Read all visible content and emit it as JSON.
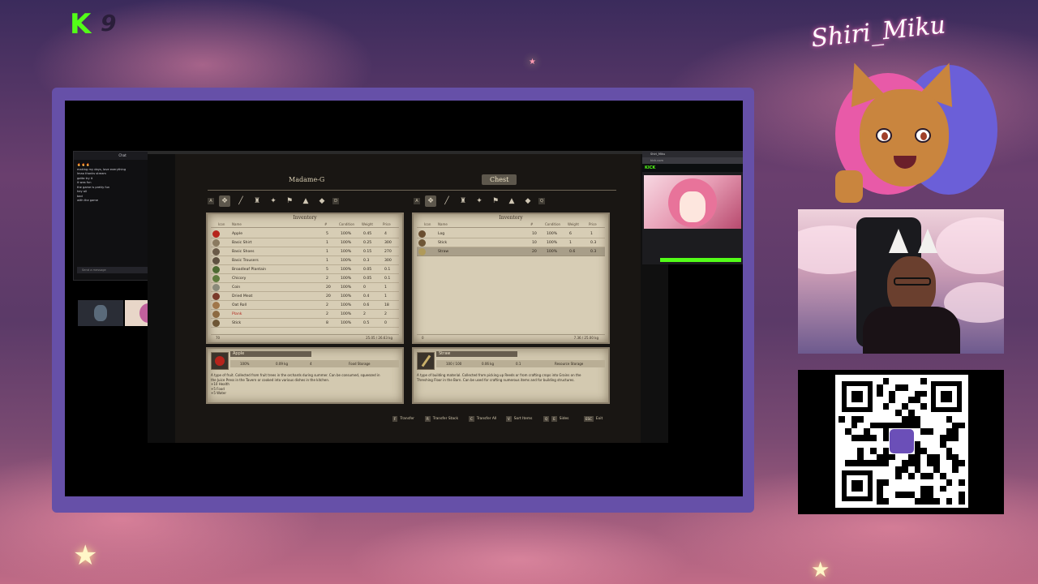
{
  "overlay": {
    "kick_logo": "K",
    "kick_count": "9",
    "brand_name": "Shiri_Miku"
  },
  "game": {
    "left_title": "Madame-G",
    "right_title": "Chest",
    "category_keys": {
      "left_prev": "A",
      "left_next": "D",
      "right_prev": "A",
      "right_next": "Q"
    },
    "left_inventory": {
      "title": "Inventory",
      "columns": [
        "Icon",
        "Name",
        "#",
        "Condition",
        "Weight",
        "Price"
      ],
      "rows": [
        {
          "name": "Apple",
          "count": "5",
          "condition": "100%",
          "weight": "0.45",
          "price": "4",
          "icon": "apple-icon",
          "color": "#b6241c"
        },
        {
          "name": "Basic Shirt",
          "count": "1",
          "condition": "100%",
          "weight": "0.25",
          "price": "300",
          "icon": "shirt-icon",
          "color": "#8a7a60"
        },
        {
          "name": "Basic Shoes",
          "count": "1",
          "condition": "100%",
          "weight": "0.15",
          "price": "270",
          "icon": "shoes-icon",
          "color": "#6a5a48"
        },
        {
          "name": "Basic Trousers",
          "count": "1",
          "condition": "100%",
          "weight": "0.3",
          "price": "300",
          "icon": "trousers-icon",
          "color": "#5e5040"
        },
        {
          "name": "Broadleaf Plantain",
          "count": "5",
          "condition": "100%",
          "weight": "0.05",
          "price": "0.1",
          "icon": "herb-icon",
          "color": "#4d6a32"
        },
        {
          "name": "Chicory",
          "count": "2",
          "condition": "100%",
          "weight": "0.05",
          "price": "0.1",
          "icon": "herb-icon",
          "color": "#5f7b3e"
        },
        {
          "name": "Coin",
          "count": "20",
          "condition": "100%",
          "weight": "0",
          "price": "1",
          "icon": "coin-icon",
          "color": "#8a8a7a"
        },
        {
          "name": "Dried Meat",
          "count": "20",
          "condition": "100%",
          "weight": "0.4",
          "price": "1",
          "icon": "meat-icon",
          "color": "#7a3a2a"
        },
        {
          "name": "Oat Roll",
          "count": "2",
          "condition": "100%",
          "weight": "0.6",
          "price": "18",
          "icon": "bread-icon",
          "color": "#a0764a"
        },
        {
          "name": "Plank",
          "count": "2",
          "condition": "100%",
          "weight": "2",
          "price": "2",
          "icon": "plank-icon",
          "color": "#8d6a42",
          "highlight": true
        },
        {
          "name": "Stick",
          "count": "8",
          "condition": "100%",
          "weight": "0.5",
          "price": "0",
          "icon": "stick-icon",
          "color": "#6e5636"
        }
      ],
      "footer_count": "70",
      "footer_weight": "25.05 / 26.63 kg"
    },
    "right_inventory": {
      "title": "Inventory",
      "columns": [
        "Icon",
        "Name",
        "#",
        "Condition",
        "Weight",
        "Price"
      ],
      "rows": [
        {
          "name": "Log",
          "count": "10",
          "condition": "100%",
          "weight": "6",
          "price": "1",
          "icon": "log-icon",
          "color": "#6a4e30"
        },
        {
          "name": "Stick",
          "count": "10",
          "condition": "100%",
          "weight": "1",
          "price": "0.3",
          "icon": "stick-icon",
          "color": "#6e5636"
        },
        {
          "name": "Straw",
          "count": "20",
          "condition": "100%",
          "weight": "0.6",
          "price": "0.3",
          "icon": "straw-icon",
          "color": "#b09a5a",
          "selected": true
        }
      ],
      "footer_count": "0",
      "footer_weight": "7.36 / 25.00 kg"
    },
    "left_detail": {
      "name": "Apple",
      "condition": "100%",
      "weight": "0.09 kg",
      "price": "4",
      "category": "Food Storage",
      "description": [
        "A type of fruit. Collected from fruit trees in the orchards during summer. Can be consumed, squeezed in",
        "the Juice Press in the Tavern or cooked into various dishes in the kitchen.",
        "+10 Health",
        "+5 Food",
        "+5 Water"
      ]
    },
    "right_detail": {
      "name": "Straw",
      "condition": "100 / 100",
      "weight": "0.06 kg",
      "price": "0.1",
      "category": "Resource Storage",
      "description": [
        "A type of building material. Collected from picking up Reeds or from crafting crops into Grains on the",
        "Threshing Floor in the Barn. Can be used for crafting numerous items and for building structures."
      ]
    },
    "controls": [
      {
        "key": "F",
        "label": "Transfer"
      },
      {
        "key": "R",
        "label": "Transfer Stack"
      },
      {
        "key": "C",
        "label": "Transfer All"
      },
      {
        "key": "V",
        "label": "Sort Items"
      },
      {
        "key": "Q",
        "key2": "E",
        "label": "Sides"
      },
      {
        "key": "ESC",
        "label": "Exit"
      }
    ]
  },
  "chat": {
    "header": "Chat",
    "lines": [
      {
        "user": "",
        "text": "🔥 🔥 🔥"
      },
      {
        "user": "",
        "text": "making my days, love everything"
      },
      {
        "user": "",
        "text": "lmao thanks stream"
      },
      {
        "user": "",
        "text": "gotta try it"
      },
      {
        "user": "",
        "text": "it was fun"
      },
      {
        "user": "",
        "text": "the game is pretty fun"
      },
      {
        "user": "",
        "text": "hey all"
      },
      {
        "user": "",
        "text": "bad"
      },
      {
        "user": "",
        "text": "with the game"
      }
    ],
    "input_placeholder": "Send a message",
    "send_label": "Chat"
  },
  "browser": {
    "tab_label": "Shiri_Miku",
    "url": "kick.com",
    "kick_label": "KICK"
  },
  "colors": {
    "kick_green": "#53fc18",
    "frame_purple": "#6650a8",
    "parchment": "#d7cdb5"
  }
}
